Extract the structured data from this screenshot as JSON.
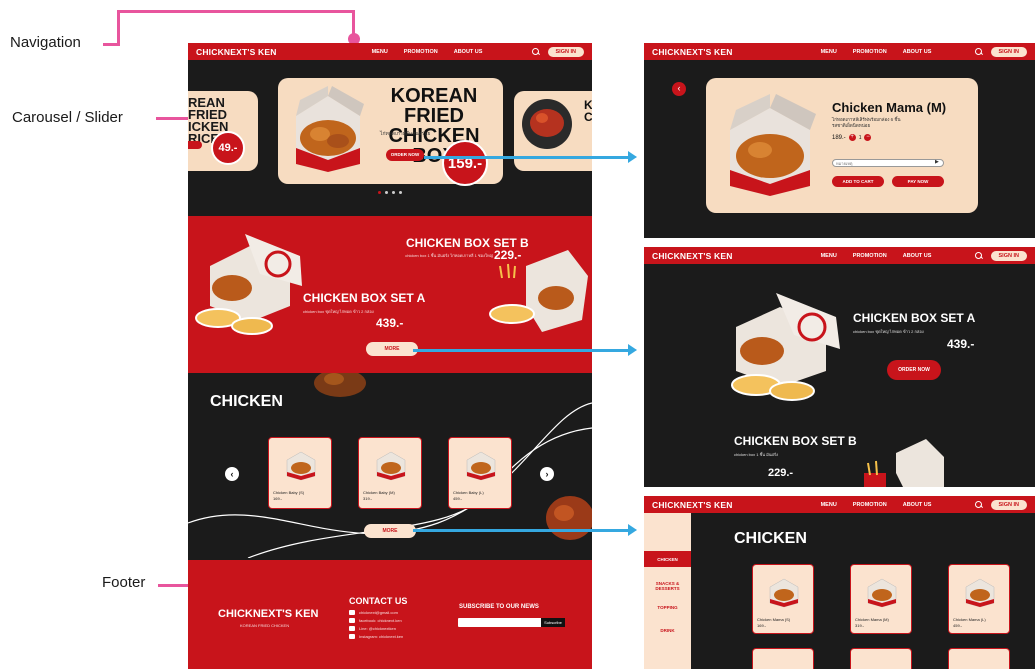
{
  "annotations": {
    "navigation": "Navigation",
    "carousel": "Carousel / Slider",
    "footer": "Footer"
  },
  "nav": {
    "brand": "CHICKNEXT'S KEN",
    "menu": "MENU",
    "promotion": "PROMOTION",
    "about": "ABOUT US",
    "signin": "SIGN IN"
  },
  "hero": {
    "title_line1": "KOREAN FRIED",
    "title_line2": "CHICKEN BOX",
    "subtitle": "ไก่ทอดเกาหลีแสนอร่อย",
    "order_button": "ORDER NOW",
    "price": "159.-",
    "prev_title_line1": "REAN FRIED",
    "prev_title_line2": "ICKEN RICE",
    "prev_price": "49.-",
    "next_title_line1": "K",
    "next_title_line2": "C"
  },
  "sets": {
    "set_b_title": "CHICKEN BOX SET B",
    "set_b_desc": "chicken box 1 ชิ้น มันฝรั่ง ไก่ทอดเกาหลี 1 ซองใหญ่",
    "set_b_price": "229.-",
    "set_a_title": "CHICKEN BOX SET A",
    "set_a_desc": "chicken box ชุดใหญ่ ไก่ทอด ข้าว 2 กล่อง",
    "set_a_price": "439.-",
    "more_button": "MORE"
  },
  "chicken_section": {
    "title": "CHICKEN",
    "products": [
      {
        "name": "Chicken Baby (S)",
        "price": "169.-"
      },
      {
        "name": "Chicken Baby (M)",
        "price": "319.-"
      },
      {
        "name": "Chicken Baby (L)",
        "price": "459.-"
      }
    ],
    "more_button": "MORE"
  },
  "footer": {
    "brand": "CHICKNEXT'S KEN",
    "tagline": "KOREAN FRIED CHICKEN",
    "contact_title": "CONTACT US",
    "contacts": [
      "chicknext@gmail.com",
      "facebook: chicknext.ken",
      "Line: @chicknextken",
      "Instagram: chicknext.ken"
    ],
    "subscribe_title": "SUBSCRIBE TO OUR NEWS",
    "subscribe_placeholder": "",
    "subscribe_button": "Subscribe"
  },
  "detail": {
    "title": "Chicken Mama (M)",
    "desc_line1": "ไก่ทอดเกาหลีเสิร์ฟพร้อมกล่อง 6 ชิ้น",
    "desc_line2": "รสชาติเผ็ดนิดหน่อย",
    "price": "189.-",
    "qty": "1",
    "note_placeholder": "หมายเหตุ",
    "add_to_cart": "ADD TO CART",
    "pay_now": "PAY NOW"
  },
  "set_detail": {
    "set_a_title": "CHICKEN BOX SET A",
    "set_a_desc": "chicken box ชุดใหญ่ ไก่ทอด ข้าว 2 กล่อง",
    "set_a_price": "439.-",
    "order_button": "ORDER NOW",
    "set_b_title": "CHICKEN BOX SET B",
    "set_b_desc": "chicken box 1 ชิ้น มันฝรั่ง",
    "set_b_price": "229.-"
  },
  "menu_page": {
    "title": "CHICKEN",
    "sidebar": [
      "CHICKEN",
      "SNACKS & DESSERTS",
      "TOPPING",
      "DRINK"
    ],
    "products": [
      {
        "name": "Chicken Mama (S)",
        "price": "169.-"
      },
      {
        "name": "Chicken Mama (M)",
        "price": "319.-"
      },
      {
        "name": "Chicken Mama (L)",
        "price": "459.-"
      }
    ]
  },
  "colors": {
    "brand_red": "#c8141b",
    "cream": "#f7dcc1",
    "dark": "#1a1a1a",
    "annotation_pink": "#e8559d",
    "arrow_blue": "#35a8e0"
  }
}
